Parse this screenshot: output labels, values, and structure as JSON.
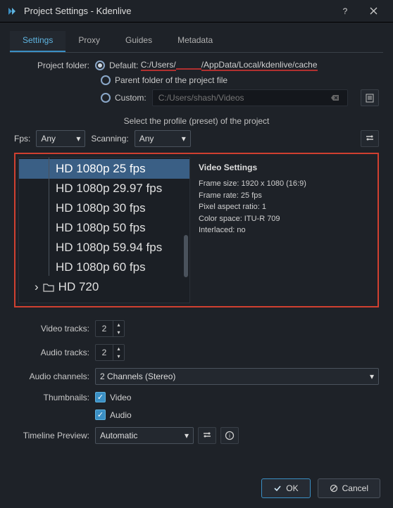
{
  "window": {
    "title": "Project Settings - Kdenlive"
  },
  "tabs": [
    "Settings",
    "Proxy",
    "Guides",
    "Metadata"
  ],
  "project_folder": {
    "label": "Project folder:",
    "default_label": "Default:",
    "default_path_pre": "C:/Users/",
    "default_path_post": "/AppData/Local/kdenlive/cache",
    "parent_label": "Parent folder of the project file",
    "custom_label": "Custom:",
    "custom_placeholder": "C:/Users/shash/Videos"
  },
  "profile_caption": "Select the profile (preset) of the project",
  "fps": {
    "label": "Fps:",
    "value": "Any"
  },
  "scanning": {
    "label": "Scanning:",
    "value": "Any"
  },
  "profiles": {
    "items": [
      "HD 1080p 25 fps",
      "HD 1080p 29.97 fps",
      "HD 1080p 30 fps",
      "HD 1080p 50 fps",
      "HD 1080p 59.94 fps",
      "HD 1080p 60 fps"
    ],
    "groups": [
      "HD 720"
    ]
  },
  "video_settings": {
    "heading": "Video Settings",
    "frame_size": "Frame size: 1920 x 1080 (16:9)",
    "frame_rate": "Frame rate: 25 fps",
    "pixel_aspect": "Pixel aspect ratio: 1",
    "color_space": "Color space: ITU-R 709",
    "interlaced": "Interlaced: no"
  },
  "video_tracks": {
    "label": "Video tracks:",
    "value": "2"
  },
  "audio_tracks": {
    "label": "Audio tracks:",
    "value": "2"
  },
  "audio_channels": {
    "label": "Audio channels:",
    "value": "2 Channels (Stereo)"
  },
  "thumbnails": {
    "label": "Thumbnails:",
    "video": "Video",
    "audio": "Audio"
  },
  "timeline_preview": {
    "label": "Timeline Preview:",
    "value": "Automatic"
  },
  "buttons": {
    "ok": "OK",
    "cancel": "Cancel"
  }
}
